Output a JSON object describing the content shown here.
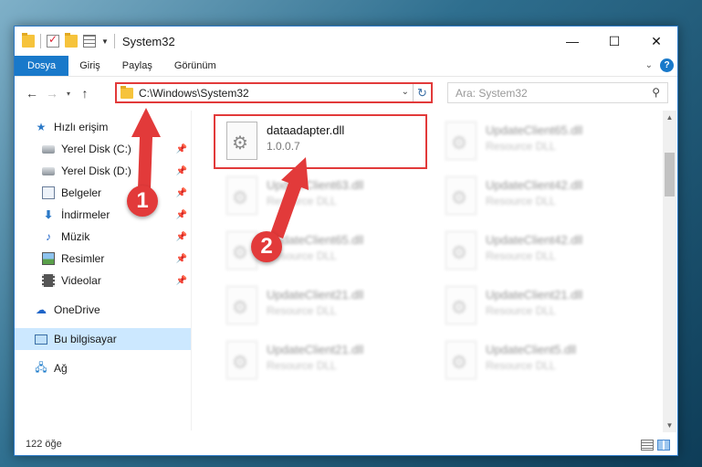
{
  "window": {
    "title": "System32",
    "controls": {
      "minimize": "—",
      "maximize": "☐",
      "close": "✕"
    }
  },
  "ribbon": {
    "tabs": [
      "Dosya",
      "Giriş",
      "Paylaş",
      "Görünüm"
    ],
    "help": "?"
  },
  "nav": {
    "address": "C:\\Windows\\System32",
    "search_placeholder": "Ara: System32"
  },
  "sidebar": {
    "items": [
      {
        "label": "Hızlı erişim",
        "icon": "star-icon"
      },
      {
        "label": "Yerel Disk (C:)",
        "icon": "disk-icon",
        "pinned": true
      },
      {
        "label": "Yerel Disk (D:)",
        "icon": "disk-icon",
        "pinned": true
      },
      {
        "label": "Belgeler",
        "icon": "documents-icon",
        "pinned": true
      },
      {
        "label": "İndirmeler",
        "icon": "download-icon",
        "pinned": true
      },
      {
        "label": "Müzik",
        "icon": "music-icon",
        "pinned": true
      },
      {
        "label": "Resimler",
        "icon": "pictures-icon",
        "pinned": true
      },
      {
        "label": "Videolar",
        "icon": "videos-icon",
        "pinned": true
      },
      {
        "label": "OneDrive",
        "icon": "onedrive-icon"
      },
      {
        "label": "Bu bilgisayar",
        "icon": "computer-icon",
        "selected": true
      },
      {
        "label": "Ağ",
        "icon": "network-icon"
      }
    ]
  },
  "files": [
    {
      "name": "dataadapter.dll",
      "sub": "1.0.0.7",
      "highlight": true
    },
    {
      "name": "UpdateClient65.dll",
      "sub": "Resource DLL"
    },
    {
      "name": "UpdateClient63.dll",
      "sub": "Resource DLL"
    },
    {
      "name": "UpdateClient42.dll",
      "sub": "Resource DLL"
    },
    {
      "name": "UpdateClient65.dll",
      "sub": "Resource DLL"
    },
    {
      "name": "UpdateClient42.dll",
      "sub": "Resource DLL"
    },
    {
      "name": "UpdateClient21.dll",
      "sub": "Resource DLL"
    },
    {
      "name": "UpdateClient21.dll",
      "sub": "Resource DLL"
    },
    {
      "name": "UpdateClient21.dll",
      "sub": "Resource DLL"
    },
    {
      "name": "UpdateClient5.dll",
      "sub": "Resource DLL"
    }
  ],
  "status": {
    "count": "122 öğe"
  },
  "annotations": {
    "step1": "1",
    "step2": "2"
  },
  "colors": {
    "accent": "#1979ca",
    "annotation": "#e23a3a",
    "selected": "#cce8ff"
  }
}
